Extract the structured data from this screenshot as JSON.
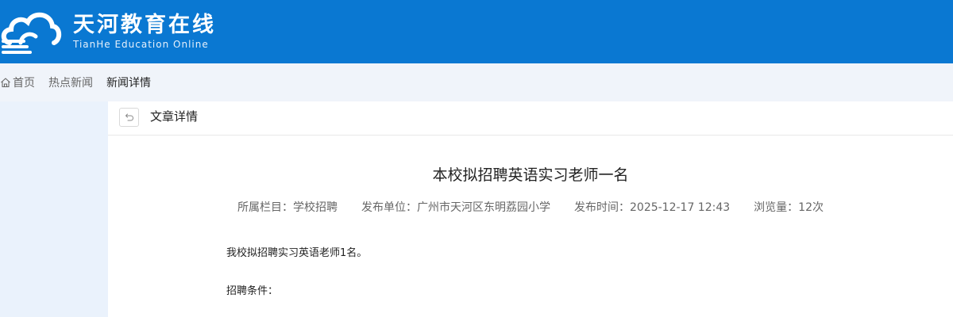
{
  "brand": {
    "title": "天河教育在线",
    "subtitle": "TianHe Education Online",
    "logo_icon": "cloud-logo-icon",
    "color": "#0a78d2"
  },
  "breadcrumb": {
    "home": "首页",
    "home_icon": "home-icon",
    "hot_news": "热点新闻",
    "current": "新闻详情"
  },
  "content_header": {
    "back_icon": "back-arrow-icon",
    "title": "文章详情"
  },
  "article": {
    "title": "本校拟招聘英语实习老师一名",
    "meta": {
      "column": "所属栏目：学校招聘",
      "publisher": "发布单位：广州市天河区东明荔园小学",
      "time": "发布时间：2025-12-17 12:43",
      "views": "浏览量：12次"
    },
    "paragraphs": [
      "我校拟招聘实习英语老师1名。",
      "招聘条件："
    ]
  }
}
